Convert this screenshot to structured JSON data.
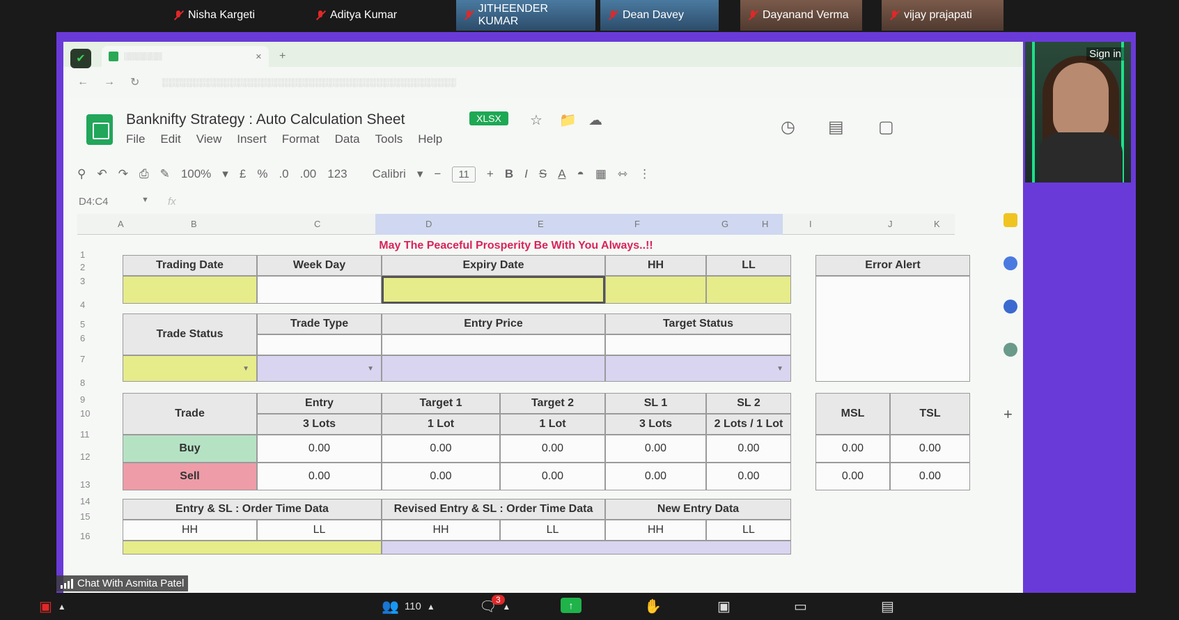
{
  "participants": [
    {
      "name": "Nisha Kargeti"
    },
    {
      "name": "Aditya Kumar"
    },
    {
      "name": "JITHEENDER KUMAR"
    },
    {
      "name": "Dean Davey"
    },
    {
      "name": "Dayanand Verma"
    },
    {
      "name": "vijay prajapati"
    }
  ],
  "presenter": {
    "signin": "Sign in"
  },
  "sheet": {
    "title": "Banknifty Strategy : Auto Calculation Sheet",
    "badge": "XLSX",
    "menu": [
      "File",
      "Edit",
      "View",
      "Insert",
      "Format",
      "Data",
      "Tools",
      "Help"
    ],
    "zoom": "100%",
    "font": "Calibri",
    "font_size": "11",
    "name_box": "D4:C4",
    "fx": "fx",
    "columns": [
      "A",
      "B",
      "C",
      "D",
      "E",
      "F",
      "G",
      "H",
      "I",
      "J",
      "K"
    ],
    "rows": [
      "1",
      "2",
      "3",
      "4",
      "5",
      "6",
      "7",
      "8",
      "9",
      "10",
      "11",
      "12",
      "13",
      "14",
      "15",
      "16"
    ],
    "motto": "May The Peaceful Prosperity Be With You Always..!!",
    "top_headers": {
      "trading_date": "Trading Date",
      "week_day": "Week Day",
      "expiry_date": "Expiry Date",
      "hh": "HH",
      "ll": "LL",
      "error_alert": "Error Alert"
    },
    "status_headers": {
      "trade_status": "Trade Status",
      "trade_type": "Trade Type",
      "entry_price": "Entry Price",
      "target_status": "Target  Status"
    },
    "trade_table": {
      "trade": "Trade",
      "entry": "Entry",
      "entry_lots": "3 Lots",
      "target1": "Target 1",
      "target1_lots": "1 Lot",
      "target2": "Target 2",
      "target2_lots": "1 Lot",
      "sl1": "SL 1",
      "sl1_lots": "3 Lots",
      "sl2": "SL 2",
      "sl2_lots": "2 Lots / 1 Lot",
      "msl": "MSL",
      "tsl": "TSL",
      "buy": "Buy",
      "sell": "Sell",
      "buy_values": [
        "0.00",
        "0.00",
        "0.00",
        "0.00",
        "0.00",
        "0.00",
        "0.00"
      ],
      "sell_values": [
        "0.00",
        "0.00",
        "0.00",
        "0.00",
        "0.00",
        "0.00",
        "0.00"
      ]
    },
    "order_table": {
      "entry_sl": "Entry & SL : Order Time Data",
      "revised": "Revised Entry & SL : Order Time Data",
      "new_entry": "New Entry Data",
      "hh": "HH",
      "ll": "LL"
    }
  },
  "chat_label": "Chat With Asmita Patel",
  "bottom": {
    "participants_count": "110",
    "chat_badge": "3"
  }
}
